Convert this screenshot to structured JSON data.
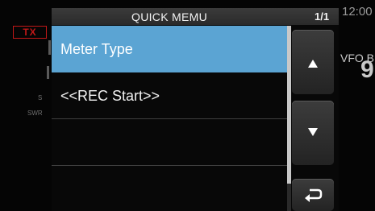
{
  "header": {
    "title": "QUICK MEMU",
    "page": "1/1"
  },
  "menu_items": [
    {
      "label": "Meter Type",
      "selected": true
    },
    {
      "label": "<<REC Start>>",
      "selected": false
    },
    {
      "label": "",
      "selected": false
    },
    {
      "label": "",
      "selected": false
    }
  ],
  "buttons": {
    "up": "up-arrow-icon",
    "down": "down-arrow-icon",
    "back": "return-icon"
  },
  "background": {
    "tx_label": "TX",
    "clock": "12:00",
    "vfo_label": "VFO B",
    "freq_digit": "9",
    "meter_s": "S",
    "meter_swr": "SWR"
  },
  "colors": {
    "selected": "#5ba4d3",
    "tx": "#c01818"
  }
}
